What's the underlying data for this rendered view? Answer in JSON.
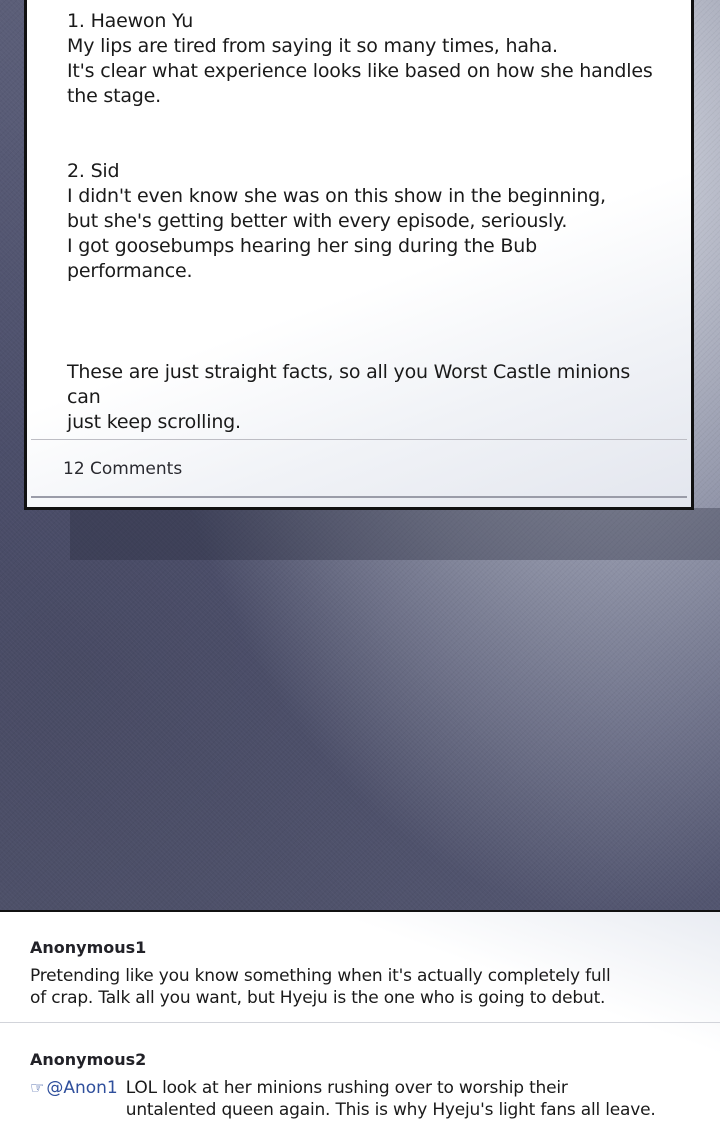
{
  "post": {
    "paragraph_1": "1. Haewon Yu\nMy lips are tired from saying it so many times, haha.\nIt's clear what experience looks like based on how she handles\nthe stage.",
    "paragraph_2": "2. Sid\nI didn't even know she was on this show in the beginning,\nbut she's getting better with every episode, seriously.\nI got goosebumps hearing her sing during the Bub performance.",
    "paragraph_3": "These are just straight facts, so all you Worst Castle minions can\njust keep scrolling.",
    "comment_count": "12 Comments"
  },
  "comments": [
    {
      "author": "Anonymous1",
      "text": "Pretending like you know something when it's actually completely full\nof crap. Talk all you want, but Hyeju is the one who is going to debut."
    },
    {
      "author": "Anonymous2",
      "reply_icon": "pointing-hand-icon",
      "mention": "@Anon1",
      "text": "LOL look at her minions rushing over to worship their\nuntalented queen again. This is why Hyeju's light fans all leave."
    }
  ],
  "colors": {
    "mention": "#2f4f9c",
    "background": "#53566f",
    "card": "#ffffff"
  }
}
